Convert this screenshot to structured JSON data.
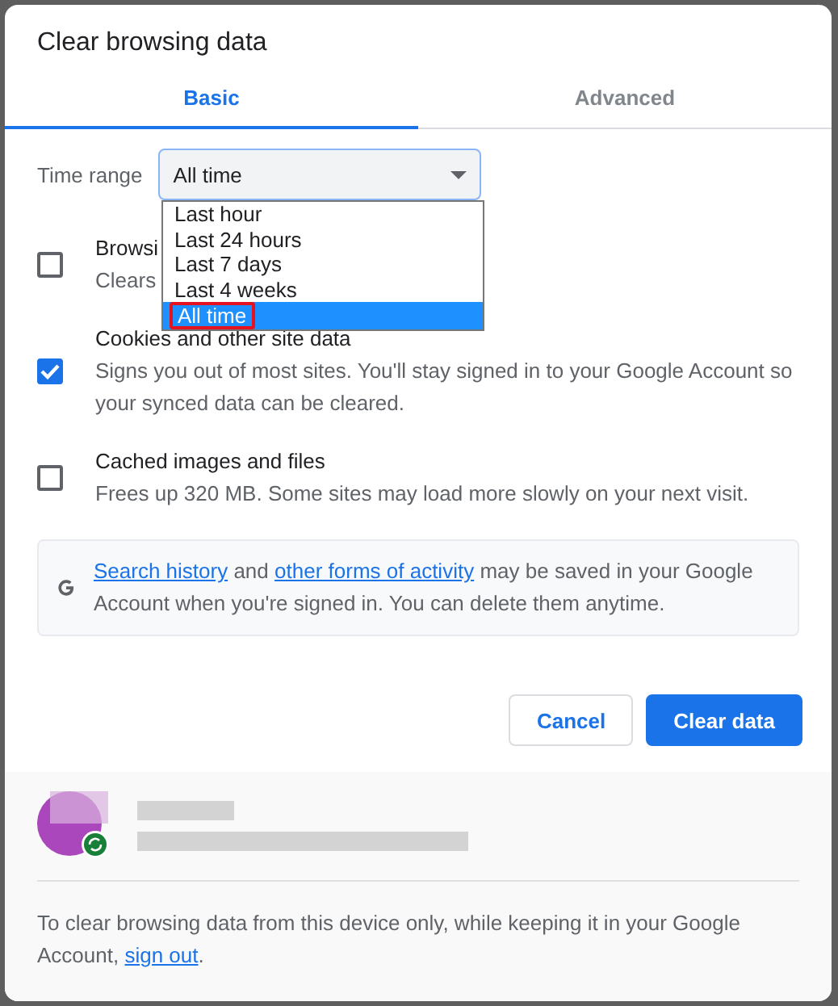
{
  "dialog": {
    "title": "Clear browsing data"
  },
  "tabs": [
    {
      "label": "Basic",
      "selected": true
    },
    {
      "label": "Advanced",
      "selected": false
    }
  ],
  "time_range": {
    "label": "Time range",
    "value": "All time",
    "expanded": true,
    "options": [
      {
        "label": "Last hour",
        "selected": false,
        "annotated": false
      },
      {
        "label": "Last 24 hours",
        "selected": false,
        "annotated": false
      },
      {
        "label": "Last 7 days",
        "selected": false,
        "annotated": false
      },
      {
        "label": "Last 4 weeks",
        "selected": false,
        "annotated": false
      },
      {
        "label": "All time",
        "selected": true,
        "annotated": true
      }
    ]
  },
  "items": [
    {
      "title": "Browsi",
      "description": "Clears",
      "checked": false
    },
    {
      "title": "Cookies and other site data",
      "description": "Signs you out of most sites. You'll stay signed in to your Google Account so your synced data can be cleared.",
      "checked": true
    },
    {
      "title": "Cached images and files",
      "description": "Frees up 320 MB. Some sites may load more slowly on your next visit.",
      "checked": false
    }
  ],
  "notice": {
    "link_1": "Search history",
    "text_1": "and",
    "link_2": "other forms of activity",
    "text_2": "may be saved in your Google Account when you're signed in. You can delete them anytime."
  },
  "buttons": {
    "cancel": "Cancel",
    "confirm": "Clear data"
  },
  "footer": {
    "text": "To clear browsing data from this device only, while keeping it in your Google Account,",
    "link": "sign out",
    "end": "."
  }
}
